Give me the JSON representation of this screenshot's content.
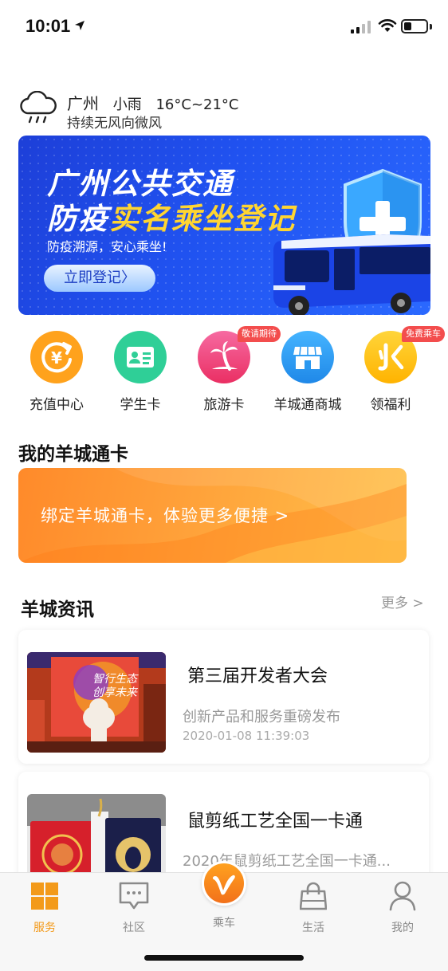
{
  "status_bar": {
    "time": "10:01"
  },
  "weather": {
    "city": "广州",
    "condition": "小雨",
    "temp_range": "16°C~21°C",
    "wind": "持续无风向微风"
  },
  "banner": {
    "title_line1": "广州公共交通",
    "title_line2_prefix": "防疫",
    "title_line2_highlight": "实名乘坐登记",
    "subtitle": "防疫溯源，安心乘坐!",
    "button_label": "立即登记〉"
  },
  "quick_menu": [
    {
      "label": "充值中心",
      "icon": "recharge-icon",
      "color": "#ffa21c"
    },
    {
      "label": "学生卡",
      "icon": "student-card-icon",
      "color": "#2fcf97"
    },
    {
      "label": "旅游卡",
      "icon": "palm-tree-icon",
      "color": "#f2437a",
      "badge": "敬请期待"
    },
    {
      "label": "羊城通商城",
      "icon": "store-icon",
      "color": "#2f9ff1"
    },
    {
      "label": "领福利",
      "icon": "welfare-icon",
      "color": "#ffc21a",
      "badge": "免费乘车"
    }
  ],
  "my_card": {
    "title": "我的羊城通卡",
    "bind_text": "绑定羊城通卡，体验更多便捷 >"
  },
  "news": {
    "title": "羊城资讯",
    "more_label": "更多 >",
    "items": [
      {
        "title": "第三届开发者大会",
        "desc": "创新产品和服务重磅发布",
        "time": "2020-01-08 11:39:03"
      },
      {
        "title": "鼠剪纸工艺全国一卡通",
        "desc": "2020年鼠剪纸工艺全国一卡通...",
        "time": ""
      }
    ]
  },
  "tab_bar": {
    "items": [
      {
        "label": "服务",
        "icon": "grid-icon",
        "active": true
      },
      {
        "label": "社区",
        "icon": "chat-icon",
        "active": false
      },
      {
        "label": "乘车",
        "icon": "ride-icon",
        "active": false
      },
      {
        "label": "生活",
        "icon": "shopping-bag-icon",
        "active": false
      },
      {
        "label": "我的",
        "icon": "person-icon",
        "active": false
      }
    ],
    "active_color": "#f39a1a"
  }
}
